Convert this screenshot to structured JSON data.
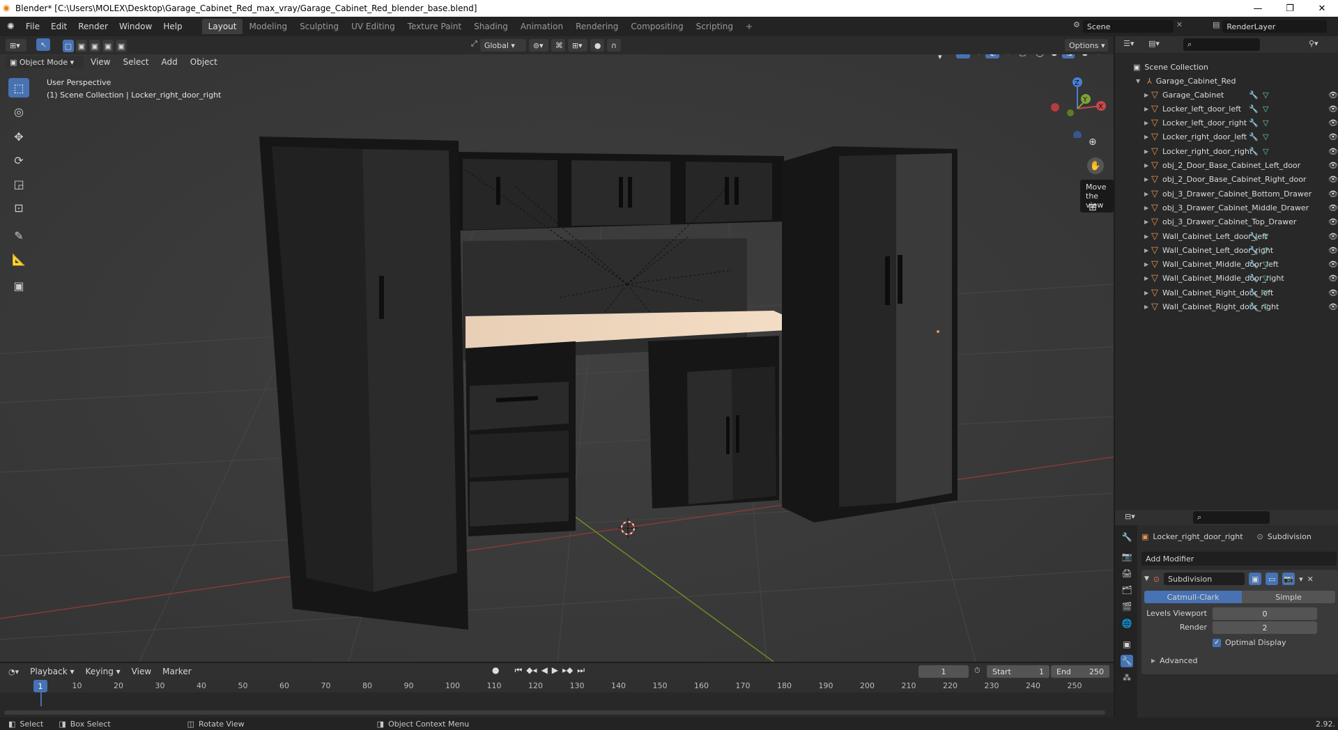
{
  "window": {
    "title": "Blender* [C:\\Users\\MOLEX\\Desktop\\Garage_Cabinet_Red_max_vray/Garage_Cabinet_Red_blender_base.blend]"
  },
  "menus": [
    "File",
    "Edit",
    "Render",
    "Window",
    "Help"
  ],
  "workspaces": [
    "Layout",
    "Modeling",
    "Sculpting",
    "UV Editing",
    "Texture Paint",
    "Shading",
    "Animation",
    "Rendering",
    "Compositing",
    "Scripting"
  ],
  "scene": {
    "name": "Scene",
    "render_layer": "RenderLayer"
  },
  "viewport_header": {
    "mode": "Object Mode",
    "menus": [
      "View",
      "Select",
      "Add",
      "Object"
    ],
    "transform": "Global",
    "options": "Options"
  },
  "viewport": {
    "overlay_line1": "User Perspective",
    "overlay_line2": "(1) Scene Collection | Locker_right_door_right",
    "tooltip": "Move the view",
    "gizmo": {
      "x": "X",
      "y": "Y",
      "z": "Z"
    }
  },
  "outliner": {
    "root": "Scene Collection",
    "parent": "Garage_Cabinet_Red",
    "items": [
      "Garage_Cabinet",
      "Locker_left_door_left",
      "Locker_left_door_right",
      "Locker_right_door_left",
      "Locker_right_door_right",
      "obj_2_Door_Base_Cabinet_Left_door",
      "obj_2_Door_Base_Cabinet_Right_door",
      "obj_3_Drawer_Cabinet_Bottom_Drawer",
      "obj_3_Drawer_Cabinet_Middle_Drawer",
      "obj_3_Drawer_Cabinet_Top_Drawer",
      "Wall_Cabinet_Left_door_left",
      "Wall_Cabinet_Left_door_right",
      "Wall_Cabinet_Middle_door_left",
      "Wall_Cabinet_Middle_door_right",
      "Wall_Cabinet_Right_door_left",
      "Wall_Cabinet_Right_door_right"
    ]
  },
  "properties": {
    "object": "Locker_right_door_right",
    "modifier_tab": "Subdivision",
    "add_modifier": "Add Modifier",
    "modifier_name": "Subdivision",
    "mode_a": "Catmull-Clark",
    "mode_b": "Simple",
    "levels_viewport_label": "Levels Viewport",
    "levels_viewport": "0",
    "render_label": "Render",
    "render": "2",
    "optimal_display": "Optimal Display",
    "advanced": "Advanced"
  },
  "timeline": {
    "menus": [
      "Playback",
      "Keying",
      "View",
      "Marker"
    ],
    "current_frame": "1",
    "start_label": "Start",
    "start": "1",
    "end_label": "End",
    "end": "250",
    "ticks": [
      "1",
      "10",
      "20",
      "30",
      "40",
      "50",
      "60",
      "70",
      "80",
      "90",
      "100",
      "110",
      "120",
      "130",
      "140",
      "150",
      "160",
      "170",
      "180",
      "190",
      "200",
      "210",
      "220",
      "230",
      "240",
      "250"
    ]
  },
  "status": {
    "select": "Select",
    "box_select": "Box Select",
    "rotate": "Rotate View",
    "context": "Object Context Menu",
    "version": "2.92."
  },
  "colors": {
    "accent": "#4772b3",
    "mesh_icon": "#e39552",
    "x_axis": "#a03a3a",
    "y_axis": "#6b8e23"
  }
}
